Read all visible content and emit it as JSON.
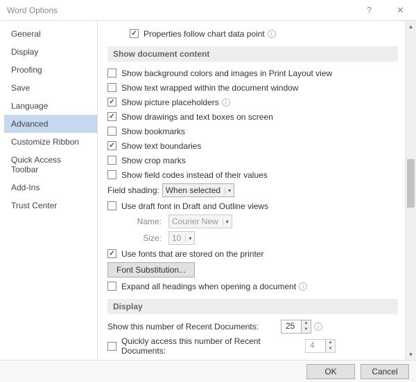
{
  "window": {
    "title": "Word Options"
  },
  "sidebar": {
    "items": [
      {
        "label": "General"
      },
      {
        "label": "Display"
      },
      {
        "label": "Proofing"
      },
      {
        "label": "Save"
      },
      {
        "label": "Language"
      },
      {
        "label": "Advanced"
      },
      {
        "label": "Customize Ribbon"
      },
      {
        "label": "Quick Access Toolbar"
      },
      {
        "label": "Add-Ins"
      },
      {
        "label": "Trust Center"
      }
    ],
    "selected": "Advanced"
  },
  "top_option": {
    "label": "Properties follow chart data point",
    "checked": true
  },
  "section_doc_content": {
    "title": "Show document content",
    "items": [
      {
        "key": "bgcolors",
        "label": "Show background colors and images in Print Layout view",
        "checked": false
      },
      {
        "key": "wrap",
        "label": "Show text wrapped within the document window",
        "checked": false
      },
      {
        "key": "picph",
        "label": "Show picture placeholders",
        "checked": true,
        "info": true
      },
      {
        "key": "drawings",
        "label": "Show drawings and text boxes on screen",
        "checked": true
      },
      {
        "key": "bookmarks",
        "label": "Show bookmarks",
        "checked": false
      },
      {
        "key": "textbound",
        "label": "Show text boundaries",
        "checked": true
      },
      {
        "key": "cropmarks",
        "label": "Show crop marks",
        "checked": false
      },
      {
        "key": "fieldcodes",
        "label": "Show field codes instead of their values",
        "checked": false
      }
    ],
    "field_shading": {
      "label": "Field shading:",
      "value": "When selected"
    },
    "draft_font": {
      "label": "Use draft font in Draft and Outline views",
      "checked": false
    },
    "draft_name": {
      "label": "Name:",
      "value": "Courier New"
    },
    "draft_size": {
      "label": "Size:",
      "value": "10"
    },
    "printer_fonts": {
      "label": "Use fonts that are stored on the printer",
      "checked": true
    },
    "font_sub_btn": "Font Substitution...",
    "expand_headings": {
      "label": "Expand all headings when opening a document",
      "checked": false,
      "info": true
    }
  },
  "section_display": {
    "title": "Display",
    "recent_docs": {
      "label": "Show this number of Recent Documents:",
      "value": "25",
      "info": true
    },
    "quick_recent": {
      "label": "Quickly access this number of Recent Documents:",
      "checked": false,
      "value": "4"
    }
  },
  "footer": {
    "ok": "OK",
    "cancel": "Cancel"
  }
}
